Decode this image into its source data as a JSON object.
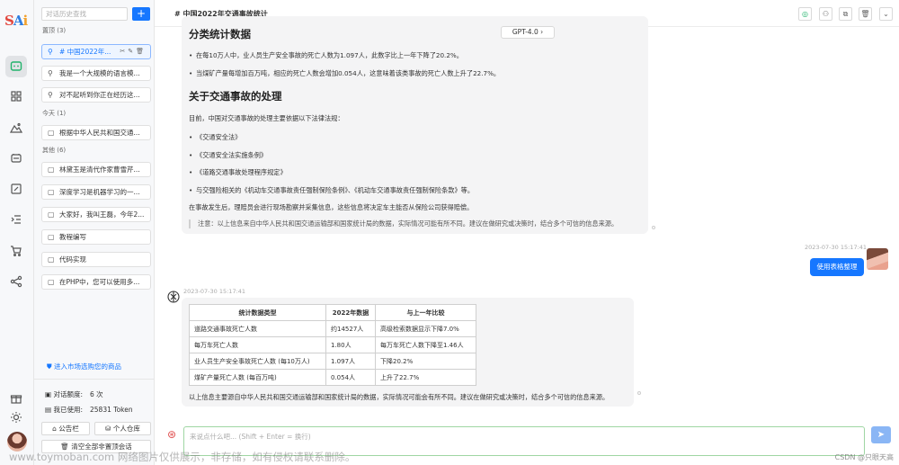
{
  "app": {
    "logo_text": "SAi",
    "accent": "#1677ff",
    "active_green": "#21b36b"
  },
  "rail": {
    "items": [
      {
        "icon": "chat-icon"
      },
      {
        "icon": "apps-grid-icon"
      },
      {
        "icon": "mountain-image-icon"
      },
      {
        "icon": "media-icon"
      },
      {
        "icon": "edit-icon"
      },
      {
        "icon": "list-indent-icon"
      },
      {
        "icon": "cart-icon"
      },
      {
        "icon": "share-icon"
      }
    ],
    "bottom_icons": [
      "gift-icon",
      "sun-icon",
      "avatar"
    ]
  },
  "sidebar": {
    "search_placeholder": "对话历史查找",
    "add_label": "+",
    "groups": [
      {
        "label": "置顶 (3)",
        "items": [
          "# 中国2022年...",
          "我是一个大规模的语言模...",
          "对不起听到你正在经历这..."
        ]
      },
      {
        "label": "今天 (1)",
        "items": [
          "根据中华人民共和国交通..."
        ]
      },
      {
        "label": "其他 (6)",
        "items": [
          "林黛玉是清代作家曹雪芹...",
          "深度学习是机器学习的一...",
          "大家好，我叫王磊，今年2...",
          "教程编写",
          "代码实现",
          "在PHP中，您可以使用多..."
        ]
      }
    ],
    "market_link": "进入市场选购您的商品",
    "quota_label": "对话额度:",
    "quota_value": "6 次",
    "used_label": "我已使用:",
    "used_value": "25831 Token",
    "announce_btn": "公告栏",
    "warehouse_btn": "个人仓库",
    "clear_btn": "清空全部非置顶会话"
  },
  "header": {
    "title": "# 中国2022年交通事故统计",
    "icons": [
      "wechat-icon",
      "add-user-icon",
      "copy-icon",
      "delete-icon",
      "chevron-down-icon"
    ]
  },
  "messages": {
    "model_label": "GPT-4.0  ›",
    "m1": {
      "h_stats": "分类统计数据",
      "bullets_stats": [
        "在每10万人中，业人员生产安全事故的死亡人数为1.097人，此数字比上一年下降了20.2%。",
        "当煤矿产量每增加百万吨，相应的死亡人数会增加0.054人，这意味着该类事故的死亡人数上升了22.7%。"
      ],
      "h_handle": "关于交通事故的处理",
      "intro": "目前，中国对交通事故的处理主要依据以下法律法规：",
      "laws": [
        "《交通安全法》",
        "《交通安全法实施条例》",
        "《道路交通事故处理程序规定》",
        "与交强险相关的《机动车交通事故责任强制保险条例》、《机动车交通事故责任强制保险条款》等。"
      ],
      "after": "在事故发生后，理赔员会进行现场勘察并采集信息，这些信息将决定车主能否从保险公司获得赔偿。",
      "note": "注意：以上信息来自中华人民共和国交通运输部和国家统计局的数据，实际情况可能有所不同。建议在做研究或决策时，结合多个可信的信息来源。"
    },
    "user": {
      "time": "2023-07-30 15:17:41",
      "text": "使用表格整理"
    },
    "m2": {
      "time": "2023-07-30 15:17:41",
      "table": {
        "headers": [
          "统计数据类型",
          "2022年数据",
          "与上一年比较"
        ],
        "rows": [
          [
            "道路交通事故死亡人数",
            "约14527人",
            "高级检索数据显示下降7.0%"
          ],
          [
            "每万车死亡人数",
            "1.80人",
            "每万车死亡人数下降至1.46人"
          ],
          [
            "业人员生产安全事故死亡人数 (每10万人)",
            "1.097人",
            "下降20.2%"
          ],
          [
            "煤矿产量死亡人数 (每百万吨)",
            "0.054人",
            "上升了22.7%"
          ]
        ]
      },
      "footer": "以上信息主要源自中华人民共和国交通运输部和国家统计局的数据，实际情况可能会有所不同。建议在做研究或决策时，结合多个可信的信息来源。"
    }
  },
  "input": {
    "placeholder": "来说点什么吧... (Shift + Enter = 换行)",
    "send_icon": "send-icon"
  },
  "watermark": {
    "text": "www.toymoban.com 网络图片仅供展示，非存储，如有侵权请联系删除。",
    "csdn": "CSDN @只眼天高"
  }
}
